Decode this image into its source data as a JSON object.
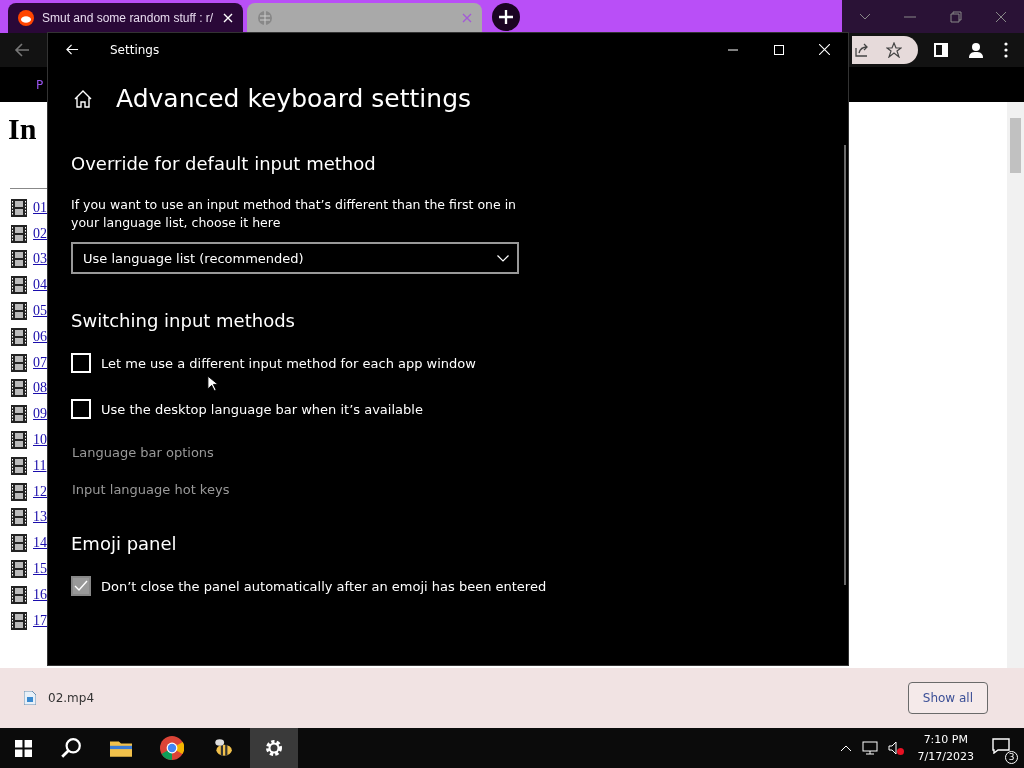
{
  "browser": {
    "tabs": [
      {
        "title": "Smut and some random stuff : r/",
        "selected": true
      },
      {
        "selected": false
      }
    ],
    "bookmark": "P",
    "page": {
      "heading": "In",
      "files": [
        "01",
        "02",
        "03",
        "04",
        "05",
        "06",
        "07",
        "08",
        "09",
        "10",
        "11",
        "12",
        "13",
        "14",
        "15",
        "16",
        "17"
      ]
    }
  },
  "settings": {
    "title": "Settings",
    "heading": "Advanced keyboard settings",
    "sections": [
      {
        "title": "Override for default input method",
        "items": [
          {
            "kind": "text",
            "text": "If you want to use an input method that’s different than the first one in your language list, choose it here"
          },
          {
            "kind": "dropdown",
            "value": "Use language list (recommended)"
          }
        ]
      },
      {
        "title": "Switching input methods",
        "items": [
          {
            "kind": "checkbox",
            "label": "Let me use a different input method for each app window",
            "checked": false,
            "disabled": false
          },
          {
            "kind": "checkbox",
            "label": "Use the desktop language bar when it’s available",
            "checked": false,
            "disabled": false
          },
          {
            "kind": "link",
            "text": "Language bar options"
          },
          {
            "kind": "link",
            "text": "Input language hot keys"
          }
        ]
      },
      {
        "title": "Emoji panel",
        "items": [
          {
            "kind": "checkbox",
            "label": "Don’t close the panel automatically after an emoji has been entered",
            "checked": true,
            "disabled": true
          }
        ]
      }
    ]
  },
  "downloads": {
    "file": "02.mp4",
    "button": "Show all"
  },
  "taskbar": {
    "time": "7:10 PM",
    "date": "7/17/2023",
    "notifications": "3"
  }
}
